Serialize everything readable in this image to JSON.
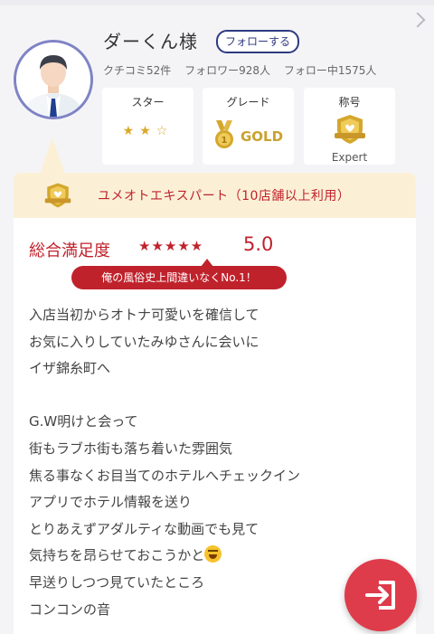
{
  "profile": {
    "name": "ダーくん様",
    "follow_label": "フォローする",
    "stats": {
      "reviews": "クチコミ52件",
      "followers": "フォロワー928人",
      "following": "フォロー中1575人"
    }
  },
  "cards": {
    "star": {
      "title": "スター",
      "rating": 2,
      "max": 3,
      "stars_text": "★★☆"
    },
    "grade": {
      "title": "グレード",
      "value": "GOLD"
    },
    "rank": {
      "title": "称号",
      "value": "Expert"
    }
  },
  "banner": {
    "text": "ユメオトエキスパート（10店舗以上利用）"
  },
  "review": {
    "satisfaction_label": "総合満足度",
    "stars_text": "★★★★★",
    "rating": 5,
    "score": "5.0",
    "headline": "俺の風俗史上間違いなくNo.1！",
    "lines": [
      "入店当初からオトナ可愛いを確信して",
      "お気に入りしていたみゆさんに会いに",
      "イザ錦糸町へ",
      "",
      "G.W明けと会って",
      "街もラブホ街も落ち着いた雰囲気",
      "焦る事なくお目当てのホテルへチェックイン",
      "アプリでホテル情報を送り",
      "とりあえずアダルティな動画でも見て",
      "気持ちを昂らせておこうかと",
      "早送りしつつ見ていたところ",
      "コンコンの音"
    ]
  },
  "icons": {
    "chevron": "chevron-right-icon",
    "avatar": "user-avatar",
    "grade": "gold-medal-icon",
    "rank": "expert-shield-icon",
    "banner": "expert-badge-icon",
    "emoji": "laughing-emoji-icon",
    "fab": "login-icon"
  },
  "colors": {
    "accent_red": "#c0222c",
    "gold": "#c9a22d",
    "follow_navy": "#2e3a80",
    "avatar_ring": "#7f83c4",
    "banner_bg": "#fbf0d6",
    "fab": "#de3b4b"
  }
}
